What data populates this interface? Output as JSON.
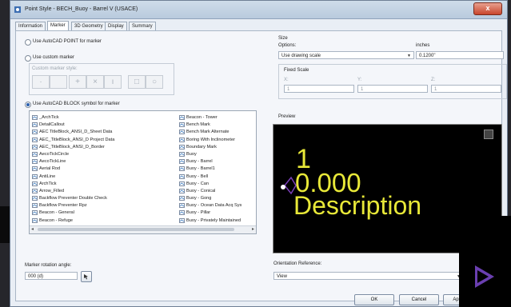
{
  "window": {
    "title": "Point Style - BECH_Buoy - Barrel V (USACE)",
    "close_glyph": "x"
  },
  "tabs": [
    "Information",
    "Marker",
    "3D Geometry",
    "Display",
    "Summary"
  ],
  "marker": {
    "opt_point": "Use AutoCAD POINT for marker",
    "opt_custom": "Use custom marker",
    "custom_style_label": "Custom marker style:",
    "custom_buttons": [
      "·",
      "",
      "+",
      "×",
      "ı",
      "□",
      "○"
    ],
    "opt_block": "Use AutoCAD BLOCK symbol for marker",
    "blocks_col1": [
      "_ArchTick",
      "DetailCallout",
      "AEC TitleBlock_ANSI_D_Sheet Data",
      "AEC_TitleBlock_ANSI_D Project Data",
      "AEC_TitleBlock_ANSI_D_Border",
      "AecoTickCircle",
      "AecoTickLine",
      "Aerial Rod",
      "AntiLine",
      "ArchTick",
      "Arrow_Filled",
      "Backflow Preventer Double Check",
      "Backflow Preventer Rpz",
      "Beacon - General",
      "Beacon - Refuge"
    ],
    "blocks_col2": [
      "Beacon - Tower",
      "Bench Mark",
      "Bench Mark Alternate",
      "Boring With Inclinometer",
      "Boundary Mark",
      "Buoy",
      "Buoy - Barrel",
      "Buoy - Barrel1",
      "Buoy - Bell",
      "Buoy - Can",
      "Buoy - Conical",
      "Buoy - Gong",
      "Buoy - Ocean Data Acq Sys",
      "Buoy - Pillar",
      "Buoy - Privately Maintained"
    ],
    "selected_block": "Buoy - Barrel",
    "rotation_label": "Marker rotation angle:",
    "rotation_value": "000 (d)"
  },
  "size": {
    "group_label": "Size",
    "options_label": "Options:",
    "options_value": "Use drawing scale",
    "inches_label": "inches",
    "inches_value": "0.1200\"",
    "fixed_scale_label": "Fixed Scale",
    "x_label": "X:",
    "x_value": "1",
    "y_label": "Y:",
    "y_value": "1",
    "z_label": "Z:",
    "z_value": "1"
  },
  "preview": {
    "label": "Preview",
    "point_number": "1",
    "elevation": "0.000",
    "description": "Description"
  },
  "orientation": {
    "label": "Orientation Reference:",
    "value": "View"
  },
  "buttons": {
    "ok": "OK",
    "cancel": "Cancel",
    "apply": "Ap"
  },
  "colors": {
    "preview_text": "#e8e838",
    "preview_bg": "#000000",
    "marker_symbol": "#7a3fb8"
  }
}
